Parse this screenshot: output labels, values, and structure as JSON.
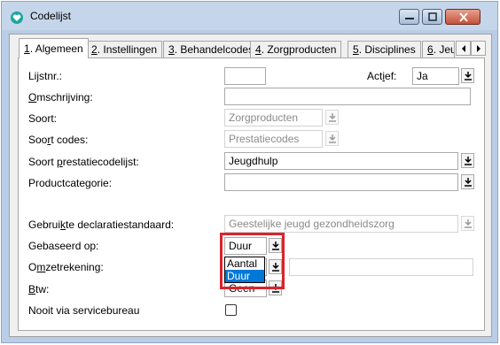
{
  "window": {
    "title": "Codelijst"
  },
  "tabs": [
    {
      "accel": "1",
      "rest": ". Algemeen"
    },
    {
      "accel": "2",
      "rest": ". Instellingen"
    },
    {
      "accel": "3",
      "rest": ". Behandelcodes"
    },
    {
      "accel": "4",
      "rest": ". Zorgproducten"
    },
    {
      "accel": "5",
      "rest": ". Disciplines"
    },
    {
      "accel": "6",
      "rest": ". Jeu"
    }
  ],
  "form": {
    "lijstnr": {
      "label": "Lijstnr.:",
      "value": ""
    },
    "actief": {
      "pre": "Act",
      "accel": "i",
      "post": "ef:",
      "value": "Ja"
    },
    "omschrijving": {
      "accel": "O",
      "post": "mschrijving:",
      "value": ""
    },
    "soort": {
      "label": "Soort:",
      "value": "Zorgproducten"
    },
    "soort_codes": {
      "pre": "Soo",
      "accel": "r",
      "post": "t codes:",
      "value": "Prestatiecodes"
    },
    "soort_prestatie": {
      "pre": "Soort ",
      "accel": "p",
      "post": "restatiecodelijst:",
      "value": "Jeugdhulp"
    },
    "productcategorie": {
      "label": "Productcategorie:",
      "value": ""
    },
    "declaratiestandaard": {
      "pre": "Gebrui",
      "accel": "k",
      "post": "te declaratiestandaard:",
      "value": "Geestelijke jeugd gezondheidszorg"
    },
    "gebaseerd_op": {
      "label": "Gebaseerd op:",
      "value": "Duur",
      "options": [
        "Aantal",
        "Duur"
      ],
      "selected": "Duur"
    },
    "omzetrekening": {
      "pre": "O",
      "accel": "m",
      "post": "zetrekening:",
      "value": ""
    },
    "btw": {
      "pre": "",
      "accel": "B",
      "post": "tw:",
      "value": "Geen"
    },
    "nooit_via": {
      "label": "Nooit via servicebureau",
      "checked": false
    }
  },
  "colors": {
    "highlight": "#d9242b",
    "selection": "#0078d7"
  }
}
